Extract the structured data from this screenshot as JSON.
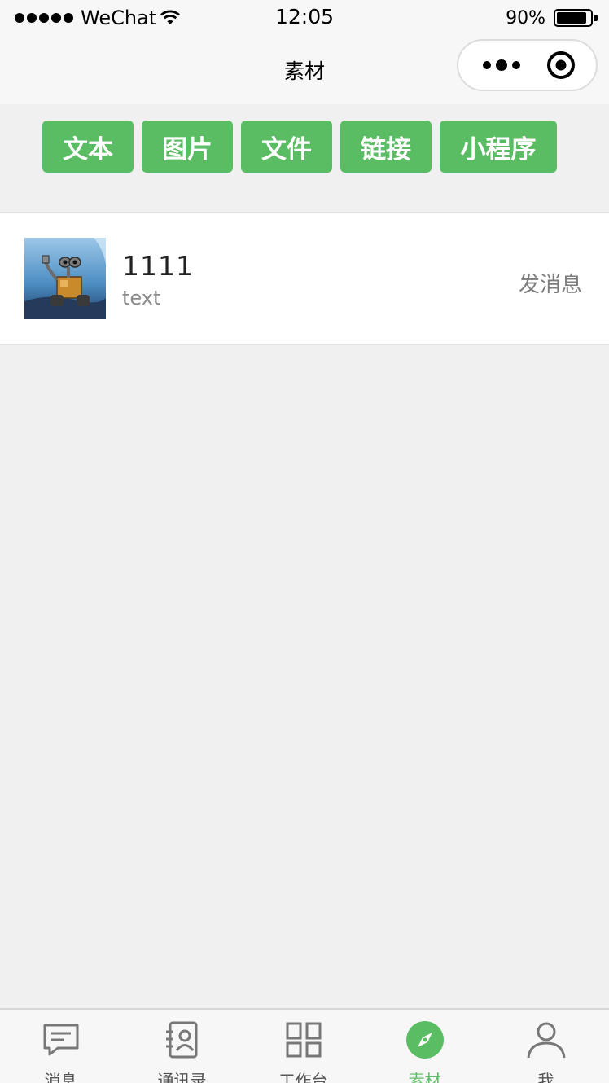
{
  "status_bar": {
    "carrier": "WeChat",
    "time": "12:05",
    "battery": "90%",
    "battery_level": 0.9
  },
  "nav": {
    "title": "素材"
  },
  "categories": [
    {
      "label": "文本"
    },
    {
      "label": "图片"
    },
    {
      "label": "文件"
    },
    {
      "label": "链接"
    },
    {
      "label": "小程序"
    }
  ],
  "items": [
    {
      "title": "1111",
      "subtitle": "text",
      "action": "发消息"
    }
  ],
  "tabs": [
    {
      "label": "消息",
      "icon": "chat-icon"
    },
    {
      "label": "通讯录",
      "icon": "contacts-icon"
    },
    {
      "label": "工作台",
      "icon": "grid-icon"
    },
    {
      "label": "素材",
      "icon": "compass-icon",
      "active": true
    },
    {
      "label": "我",
      "icon": "user-icon"
    }
  ],
  "colors": {
    "accent": "#5bbd63",
    "background": "#f0f0f0",
    "text_muted": "#8a8a8a"
  }
}
